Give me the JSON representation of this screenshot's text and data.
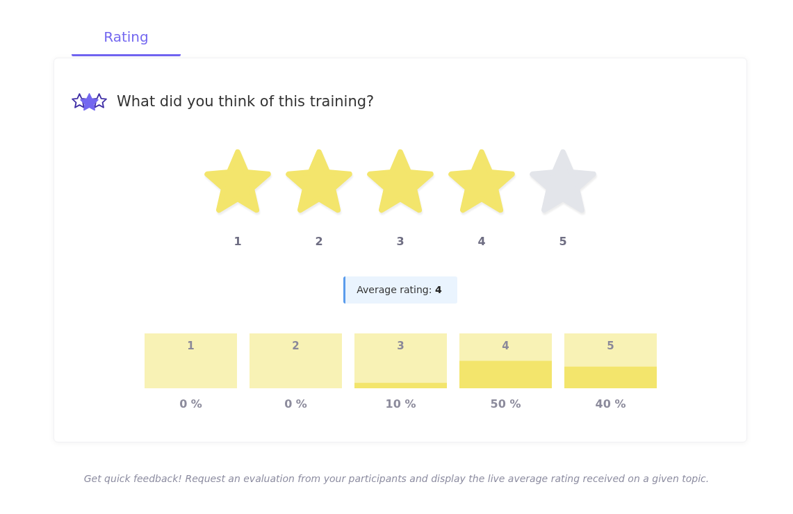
{
  "tabs": [
    {
      "label": "Rating",
      "selected": true
    }
  ],
  "question": {
    "title": "What did you think of this training?"
  },
  "rating": {
    "stars": 4,
    "labels": [
      "1",
      "2",
      "3",
      "4",
      "5"
    ]
  },
  "average": {
    "text": "Average rating: **4**"
  },
  "distribution": {
    "chart_data": {
      "type": "bar",
      "categories": [
        "1",
        "2",
        "3",
        "4",
        "5"
      ],
      "values": [
        0,
        0,
        10,
        50,
        40
      ],
      "value_labels": [
        "0 %",
        "0 %",
        "10 %",
        "50 %",
        "40 %"
      ]
    }
  },
  "footer": {
    "text": "Get quick feedback! Request an evaluation from your participants and display the live average rating received on a given topic."
  }
}
